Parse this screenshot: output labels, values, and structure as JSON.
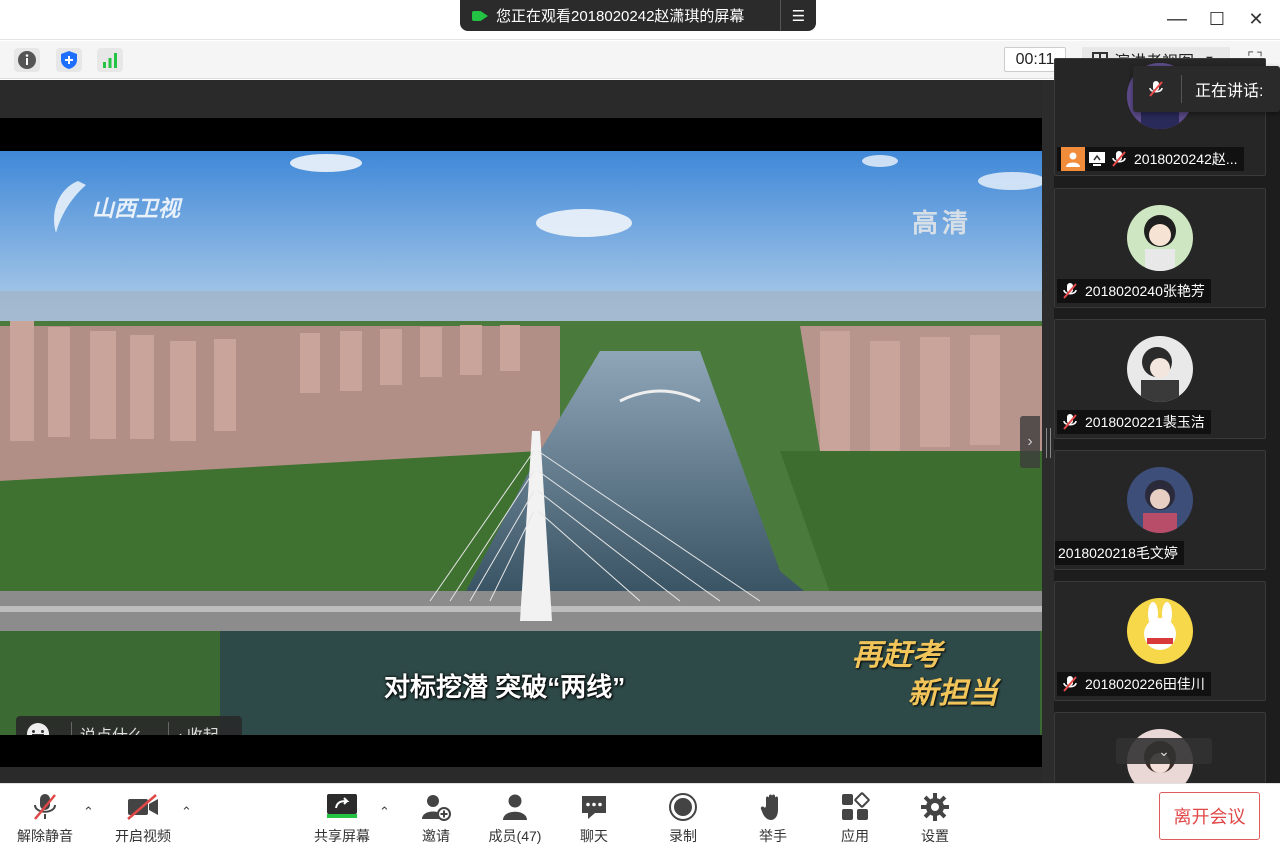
{
  "window": {
    "share_banner": "您正在观看2018020242赵潇琪的屏幕",
    "controls": {
      "minimize": "—",
      "maximize": "☐",
      "close": "✕"
    }
  },
  "toolbar": {
    "timer": "00:11",
    "view_mode": "演讲者视图",
    "icons": [
      "info-icon",
      "shield-icon",
      "signal-icon"
    ]
  },
  "video": {
    "channel_logo": "山西卫视",
    "hd_badge": "高清",
    "subtitle": "对标挖潜 突破“两线”",
    "slogan_line1": "再赶考",
    "slogan_line2": "新担当"
  },
  "chat": {
    "placeholder": "说点什么...",
    "collapse": "收起"
  },
  "speaking": {
    "label": "正在讲话:"
  },
  "participants": [
    {
      "name": "2018020242赵...",
      "host": true,
      "sharing": true,
      "muted": true
    },
    {
      "name": "2018020240张艳芳",
      "muted": true
    },
    {
      "name": "2018020221裴玉洁",
      "muted": true
    },
    {
      "name": "2018020218毛文婷",
      "muted": false
    },
    {
      "name": "2018020226田佳川",
      "muted": true
    }
  ],
  "bottom": {
    "mute": "解除静音",
    "video": "开启视频",
    "share": "共享屏幕",
    "invite": "邀请",
    "members": "成员(47)",
    "chat": "聊天",
    "record": "录制",
    "raise_hand": "举手",
    "apps": "应用",
    "settings": "设置",
    "leave": "离开会议"
  },
  "colors": {
    "accent_green": "#23c343",
    "leave_red": "#e04848",
    "host_orange": "#f08c3a",
    "shield_blue": "#1e6fff"
  }
}
